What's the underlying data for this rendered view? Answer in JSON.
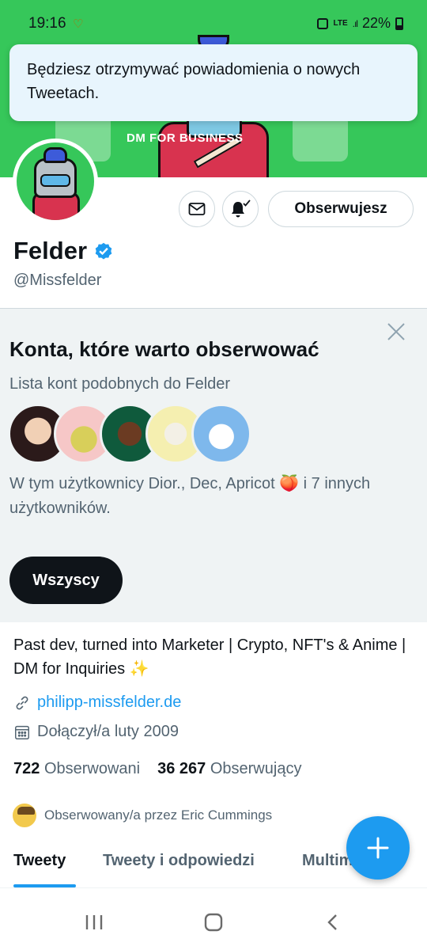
{
  "status_bar": {
    "time": "19:16",
    "network": "LTE",
    "battery": "22%"
  },
  "banner": {
    "text": "DM FOR BUSINESS"
  },
  "toast": {
    "message": "Będziesz otrzymywać powiadomienia o nowych Tweetach."
  },
  "profile": {
    "name": "Felder",
    "handle": "@Missfelder",
    "verified": true,
    "follow_button": "Obserwujesz",
    "bio": "Past dev, turned into Marketer | Crypto, NFT's & Anime | DM for Inquiries ✨",
    "website": "philipp-missfelder.de",
    "joined": "Dołączył/a luty 2009",
    "following_count": "722",
    "following_label": "Obserwowani",
    "followers_count": "36 267",
    "followers_label": "Obserwujący",
    "followed_by": "Obserwowany/a przez Eric Cummings"
  },
  "suggestions": {
    "title": "Konta, które warto obserwować",
    "subtitle": "Lista kont podobnych do Felder",
    "description": "W tym użytkownicy Dior., Dec, Apricot 🍑 i 7 innych użytkowników.",
    "button": "Wszyscy"
  },
  "tabs": [
    {
      "label": "Tweety",
      "active": true
    },
    {
      "label": "Tweety i odpowiedzi",
      "active": false
    },
    {
      "label": "Multimedia",
      "active": false
    }
  ],
  "colors": {
    "accent": "#1d9bf0",
    "banner": "#36c75a",
    "panel": "#eff3f4",
    "muted_text": "#536471"
  },
  "icons": [
    "heart-status-icon",
    "battery-saver-icon",
    "signal-icon",
    "battery-icon",
    "mail-icon",
    "bell-check-icon",
    "verified-badge-icon",
    "close-icon",
    "link-icon",
    "calendar-icon",
    "plus-icon",
    "recent-apps-icon",
    "home-icon",
    "back-icon"
  ]
}
